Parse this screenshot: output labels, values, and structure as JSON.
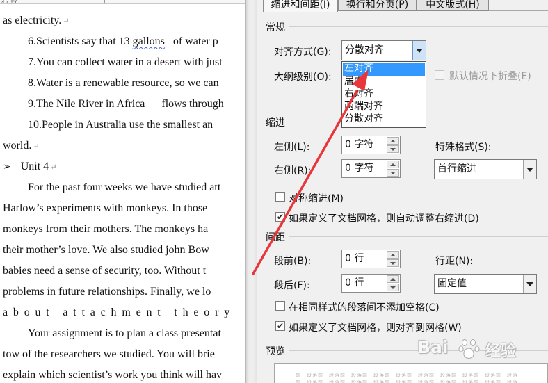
{
  "document": {
    "ruler_text": "右 台",
    "lines": [
      {
        "text": "as electricity.",
        "mark": "↵"
      },
      {
        "pre": "6.Scientists say that 13 ",
        "wavy": "gallons",
        "post": "   of water p"
      },
      {
        "text": "7.You can collect water in a desert with just"
      },
      {
        "text": "8.Water is a renewable resource, so we can"
      },
      {
        "text": "9.The Nile River in Africa      flows through"
      },
      {
        "text": "10.People in Australia use the smallest an"
      },
      {
        "text": "world.",
        "mark": "↵"
      },
      {
        "bullet": "➢",
        "text": "Unit 4",
        "mark": "↵"
      },
      {
        "text": "For the past four weeks we have studied att"
      },
      {
        "text": "Harlow’s experiments with monkeys. In those"
      },
      {
        "text": "monkeys from their mothers. The monkeys ha"
      },
      {
        "text": "their mother’s love. We also studied john Bow"
      },
      {
        "text": "babies need a sense of security, too. Without t"
      },
      {
        "text": "problems in future relationships. Finally, we lo"
      },
      {
        "text": "about attachment theory"
      },
      {
        "text": "Your assignment is to plan a class presentat"
      },
      {
        "text": "tow of the researchers we studied. You will brie"
      },
      {
        "text": "explain which scientist’s work you think will hav"
      }
    ]
  },
  "dialog": {
    "tabs": {
      "indent": "缩进和间距(I)",
      "break": "换行和分页(P)",
      "asian": "中文版式(H)"
    },
    "general": {
      "title": "常规",
      "align_label": "对齐方式(G):",
      "align_value": "分散对齐",
      "outline_label": "大纲级别(O):",
      "collapse_label": "默认情况下折叠(E)"
    },
    "align_options": [
      "左对齐",
      "居中",
      "右对齐",
      "两端对齐",
      "分散对齐"
    ],
    "align_highlighted": "左对齐",
    "indent": {
      "title": "缩进",
      "left_label": "左侧(L):",
      "left_value": "0 字符",
      "right_label": "右侧(R):",
      "right_value": "0 字符",
      "special_label": "特殊格式(S):",
      "special_value": "首行缩进",
      "mirror_label": "对称缩进(M)",
      "mirror_checked": false,
      "grid_label": "如果定义了文档网格，则自动调整右缩进(D)",
      "grid_checked": true
    },
    "spacing": {
      "title": "间距",
      "before_label": "段前(B):",
      "before_value": "0 行",
      "after_label": "段后(F):",
      "after_value": "0 行",
      "line_label": "行距(N):",
      "line_value": "固定值",
      "no_space_label": "在相同样式的段落间不添加空格(C)",
      "no_space_checked": false,
      "snap_label": "如果定义了文档网格，则对齐到网格(W)",
      "snap_checked": true
    },
    "preview": {
      "title": "预览",
      "sample_text": "前一段落前一段落前一段落前一段落前一段落前一段落前一段落前一段落前一段落前一段落"
    }
  },
  "watermark": {
    "latin": "Bai",
    "cn": "经验"
  },
  "colors": {
    "highlight": "#3399ff",
    "arrow": "#e8363a",
    "dialog_bg": "#f0f0f0"
  }
}
